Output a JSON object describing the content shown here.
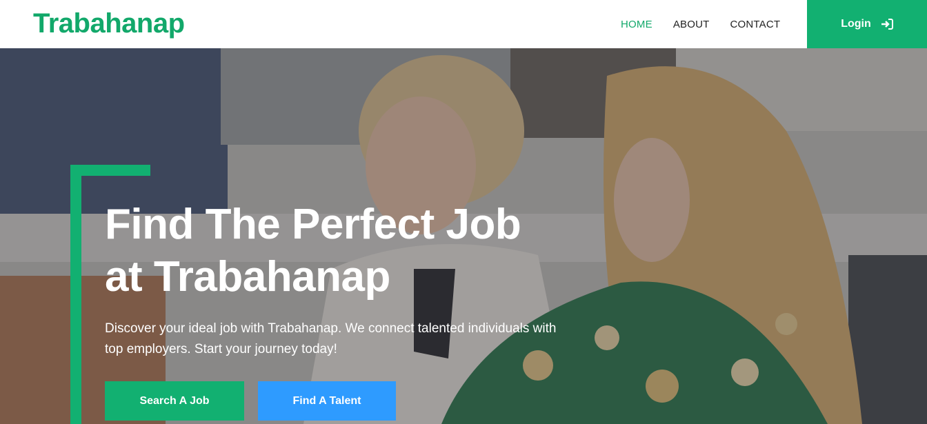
{
  "brand": {
    "name": "Trabahanap",
    "color": "#12a86a"
  },
  "nav": {
    "items": [
      {
        "label": "HOME",
        "active": true
      },
      {
        "label": "ABOUT",
        "active": false
      },
      {
        "label": "CONTACT",
        "active": false
      }
    ],
    "login_label": "Login",
    "login_icon": "sign-in-icon"
  },
  "hero": {
    "title_line1": "Find The Perfect Job",
    "title_line2": "at Trabahanap",
    "subtitle_line1": "Discover your ideal job with Trabahanap. We connect talented individuals with",
    "subtitle_line2": "top employers. Start your journey today!",
    "primary_button": "Search A Job",
    "secondary_button": "Find A Talent"
  },
  "colors": {
    "accent": "#12b071",
    "secondary": "#2e9bff",
    "text_dark": "#222222"
  }
}
